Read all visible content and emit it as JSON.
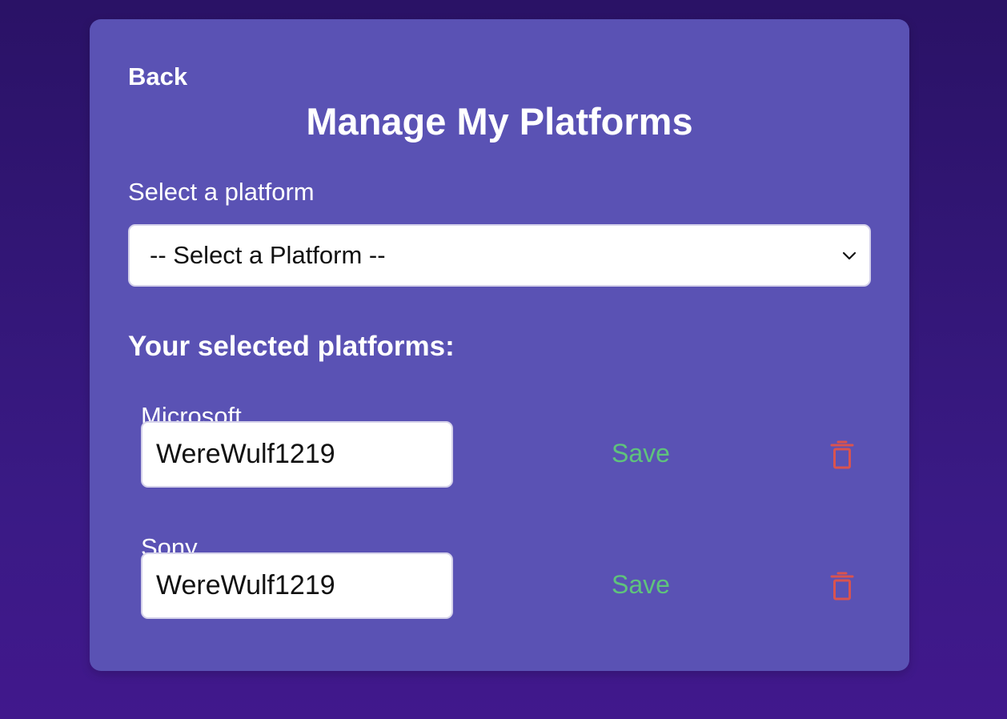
{
  "header": {
    "back_label": "Back",
    "title": "Manage My Platforms"
  },
  "platform_select": {
    "label": "Select a platform",
    "selected_value": "-- Select a Platform --"
  },
  "selected_section": {
    "heading": "Your selected platforms:",
    "platforms": [
      {
        "name": "Microsoft",
        "username": "WereWulf1219",
        "save_label": "Save",
        "delete_icon": "trash-icon"
      },
      {
        "name": "Sony",
        "username": "WereWulf1219",
        "save_label": "Save",
        "delete_icon": "trash-icon"
      }
    ]
  },
  "colors": {
    "background": "#2a1266",
    "card": "#5a52b4",
    "save": "#5fc37c",
    "delete": "#d9534f"
  }
}
